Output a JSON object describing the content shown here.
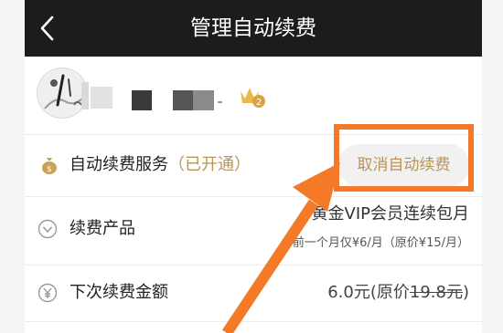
{
  "navbar": {
    "title": "管理自动续费",
    "back_icon": "chevron-left-icon"
  },
  "account": {
    "avatar_icon": "avatar-ink-painting",
    "vip_badge": "crown-v2-icon",
    "vip_level": "2"
  },
  "service": {
    "icon": "money-bag-icon",
    "label": "自动续费服务",
    "status": "（已开通）",
    "cancel_label": "取消自动续费"
  },
  "product": {
    "icon": "chevron-down-circle-icon",
    "label": "续费产品",
    "name": "黄金VIP会员连续包月",
    "price_note": "前一个月仅¥6/月（原价¥15/月）"
  },
  "next_renewal": {
    "icon": "yen-circle-icon",
    "label": "下次续费金额",
    "amount": "6.0元(原价",
    "original": "19.8元",
    "close": ")"
  },
  "colors": {
    "navbar": "#1c1c1c",
    "accent_gold": "#b89557",
    "annotation_orange": "#f47a28"
  }
}
